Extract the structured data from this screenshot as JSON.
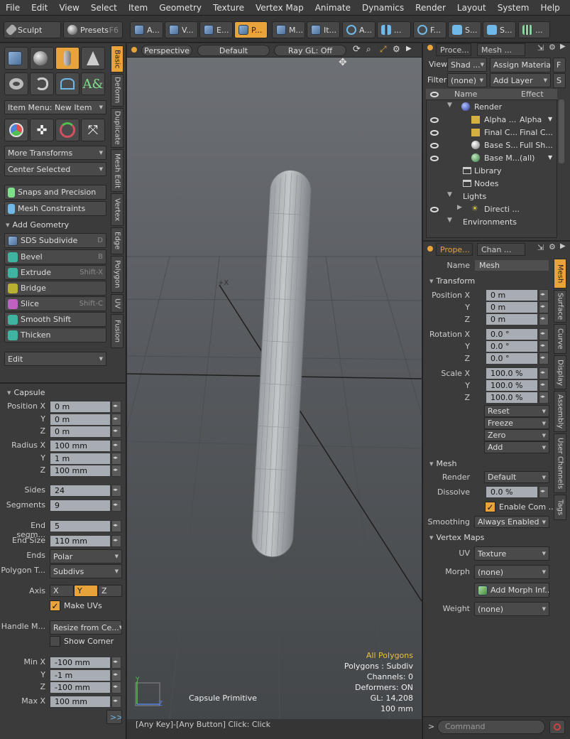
{
  "menu": [
    "File",
    "Edit",
    "View",
    "Select",
    "Item",
    "Geometry",
    "Texture",
    "Vertex Map",
    "Animate",
    "Dynamics",
    "Render",
    "Layout",
    "System",
    "Help"
  ],
  "toolbar": {
    "sculpt": "Sculpt",
    "presets": "Presets",
    "presets_key": "F6",
    "modes": [
      "A...",
      "V...",
      "E...",
      "P...",
      "M...",
      "It...",
      "A...",
      "...",
      "F...",
      "S...",
      "S..."
    ]
  },
  "left": {
    "item_menu": "Item Menu: New Item",
    "more_transforms": "More Transforms",
    "center_selected": "Center Selected",
    "snaps": "Snaps and Precision",
    "mesh_constraints": "Mesh Constraints",
    "add_geometry": "Add Geometry",
    "tools": [
      {
        "label": "SDS Subdivide",
        "key": "D"
      },
      {
        "label": "Bevel",
        "key": "B"
      },
      {
        "label": "Extrude",
        "key": "Shift-X"
      },
      {
        "label": "Bridge",
        "key": ""
      },
      {
        "label": "Slice",
        "key": "Shift-C"
      },
      {
        "label": "Smooth Shift",
        "key": ""
      },
      {
        "label": "Thicken",
        "key": ""
      }
    ],
    "edit": "Edit",
    "vtabs": [
      "Basic",
      "Deform",
      "Duplicate",
      "Mesh Edit",
      "Vertex",
      "Edge",
      "Polygon",
      "UV",
      "Fusion"
    ]
  },
  "capsule": {
    "title": "Capsule",
    "pos_label": "Position X",
    "pos": [
      "0 m",
      "0 m",
      "0 m"
    ],
    "rad_label": "Radius X",
    "rad": [
      "100 mm",
      "1 m",
      "100 mm"
    ],
    "y": "Y",
    "z": "Z",
    "x": "X",
    "sides_label": "Sides",
    "sides": "24",
    "segments_label": "Segments",
    "segments": "9",
    "endseg_label": "End segm...",
    "endseg": "5",
    "endsize_label": "End Size",
    "endsize": "110 mm",
    "ends_label": "Ends",
    "ends": "Polar",
    "polytype_label": "Polygon T...",
    "polytype": "Subdivs",
    "axis_label": "Axis",
    "axis": [
      "X",
      "Y",
      "Z"
    ],
    "make_uvs": "Make UVs",
    "handle_label": "Handle M...",
    "handle": "Resize from Ce...",
    "show_corner": "Show Corner",
    "min_label": "Min X",
    "min": [
      "-100 mm",
      "-1 m",
      "-100 mm"
    ],
    "max_label": "Max X",
    "max": "100 mm",
    "more": ">>"
  },
  "viewport": {
    "view": "Perspective",
    "shading": "Default",
    "raygl": "Ray GL: Off",
    "hud_title": "All Polygons",
    "hud": [
      "Polygons : Subdiv",
      "Channels: 0",
      "Deformers: ON",
      "GL: 14,208",
      "100 mm"
    ],
    "caption": "Capsule Primitive",
    "axis_x": "+X",
    "status": "[Any Key]-[Any Button] Click:  Click"
  },
  "items": {
    "tabs": [
      "Proce...",
      "Mesh ..."
    ],
    "view_label": "View",
    "view": "Shad ...",
    "assign": "Assign Material",
    "f": "F",
    "filter_label": "Filter",
    "filter": "(none)",
    "add_layer": "Add Layer",
    "s": "S",
    "col_name": "Name",
    "col_effect": "Effect",
    "rows": [
      {
        "name": "Render",
        "effect": ""
      },
      {
        "name": "Alpha ...",
        "effect": "Alpha"
      },
      {
        "name": "Final C...",
        "effect": "Final C..."
      },
      {
        "name": "Base S...",
        "effect": "Full Sh..."
      },
      {
        "name": "Base M...",
        "effect": "(all)"
      },
      {
        "name": "Library",
        "effect": ""
      },
      {
        "name": "Nodes",
        "effect": ""
      },
      {
        "name": "Lights",
        "effect": ""
      },
      {
        "name": "Directi ...",
        "effect": ""
      },
      {
        "name": "Environments",
        "effect": ""
      }
    ]
  },
  "props": {
    "tabs": [
      "Prope...",
      "Chan ..."
    ],
    "name_label": "Name",
    "name": "Mesh",
    "transform": "Transform",
    "pos_label": "Position X",
    "pos": [
      "0 m",
      "0 m",
      "0 m"
    ],
    "rot_label": "Rotation X",
    "rot": [
      "0.0 °",
      "0.0 °",
      "0.0 °"
    ],
    "scl_label": "Scale X",
    "scl": [
      "100.0 %",
      "100.0 %",
      "100.0 %"
    ],
    "y": "Y",
    "z": "Z",
    "reset": "Reset",
    "freeze": "Freeze",
    "zero": "Zero",
    "add": "Add",
    "mesh": "Mesh",
    "render_label": "Render",
    "render": "Default",
    "dissolve_label": "Dissolve",
    "dissolve": "0.0 %",
    "enable": "Enable Com ...",
    "smoothing_label": "Smoothing",
    "smoothing": "Always Enabled",
    "vmaps": "Vertex Maps",
    "uv_label": "UV",
    "uv": "Texture",
    "morph_label": "Morph",
    "morph": "(none)",
    "add_morph": "Add Morph Inf...",
    "weight_label": "Weight",
    "weight": "(none)",
    "vtabs": [
      "Mesh",
      "Surface",
      "Curve",
      "Display",
      "Assembly",
      "User Channels",
      "Tags"
    ],
    "command": "Command",
    "prompt": ">"
  }
}
